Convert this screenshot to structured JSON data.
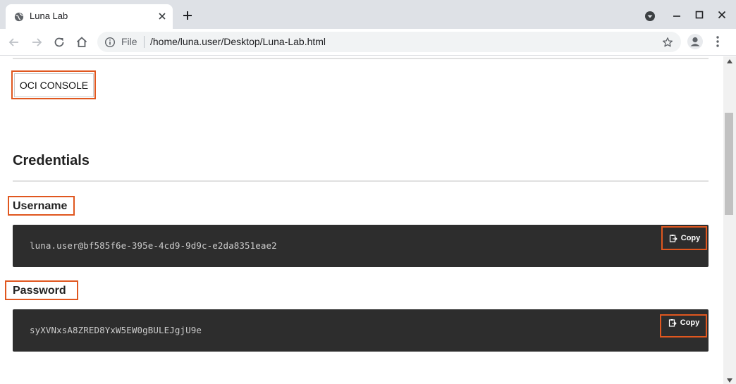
{
  "tab": {
    "title": "Luna Lab"
  },
  "address_bar": {
    "scheme": "File",
    "url": "/home/luna.user/Desktop/Luna-Lab.html"
  },
  "page": {
    "console_button": "OCI CONSOLE",
    "credentials_heading": "Credentials",
    "username": {
      "label": "Username",
      "value": "luna.user@bf585f6e-395e-4cd9-9d9c-e2da8351eae2",
      "copy_label": "Copy"
    },
    "password": {
      "label": "Password",
      "value": "syXVNxsA8ZRED8YxW5EW0gBULEJgjU9e",
      "copy_label": "Copy"
    }
  },
  "colors": {
    "highlight": "#e0571f",
    "code_background": "#2d2d2d",
    "tabstrip": "#dee1e6"
  },
  "icons": [
    "globe-icon",
    "close-icon",
    "plus-icon",
    "profile-dropdown-icon",
    "minimize-icon",
    "maximize-icon",
    "back-icon",
    "forward-icon",
    "reload-icon",
    "home-icon",
    "info-icon",
    "star-icon",
    "avatar-icon",
    "more-vert-icon",
    "clipboard-icon"
  ]
}
